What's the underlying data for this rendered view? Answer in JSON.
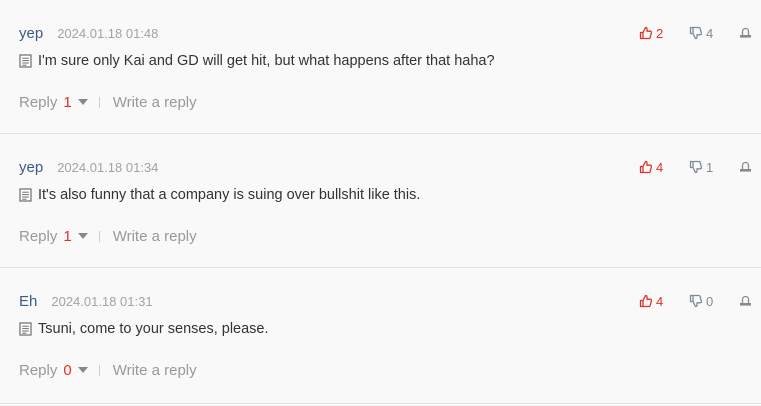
{
  "comments": [
    {
      "author": "yep",
      "date": "2024.01.18 01:48",
      "text": "I'm sure only Kai and GD will get hit, but what happens after that haha?",
      "upvotes": "2",
      "downvotes": "4",
      "reply_label": "Reply",
      "reply_count": "1",
      "write_label": "Write a reply"
    },
    {
      "author": "yep",
      "date": "2024.01.18 01:34",
      "text": "It's also funny that a company is suing over bullshit like this.",
      "upvotes": "4",
      "downvotes": "1",
      "reply_label": "Reply",
      "reply_count": "1",
      "write_label": "Write a reply"
    },
    {
      "author": "Eh",
      "date": "2024.01.18 01:31",
      "text": "Tsuni, come to your senses, please.",
      "upvotes": "4",
      "downvotes": "0",
      "reply_label": "Reply",
      "reply_count": "0",
      "write_label": "Write a reply"
    }
  ],
  "icons": {
    "upvote": "thumbs-up-icon",
    "downvote": "thumbs-down-icon",
    "report": "report-icon",
    "document": "document-icon",
    "caret": "caret-down-icon"
  },
  "colors": {
    "author": "#3d5a8a",
    "accent_red": "#e0302b",
    "muted": "#999999",
    "downvote": "#7b8b96"
  }
}
